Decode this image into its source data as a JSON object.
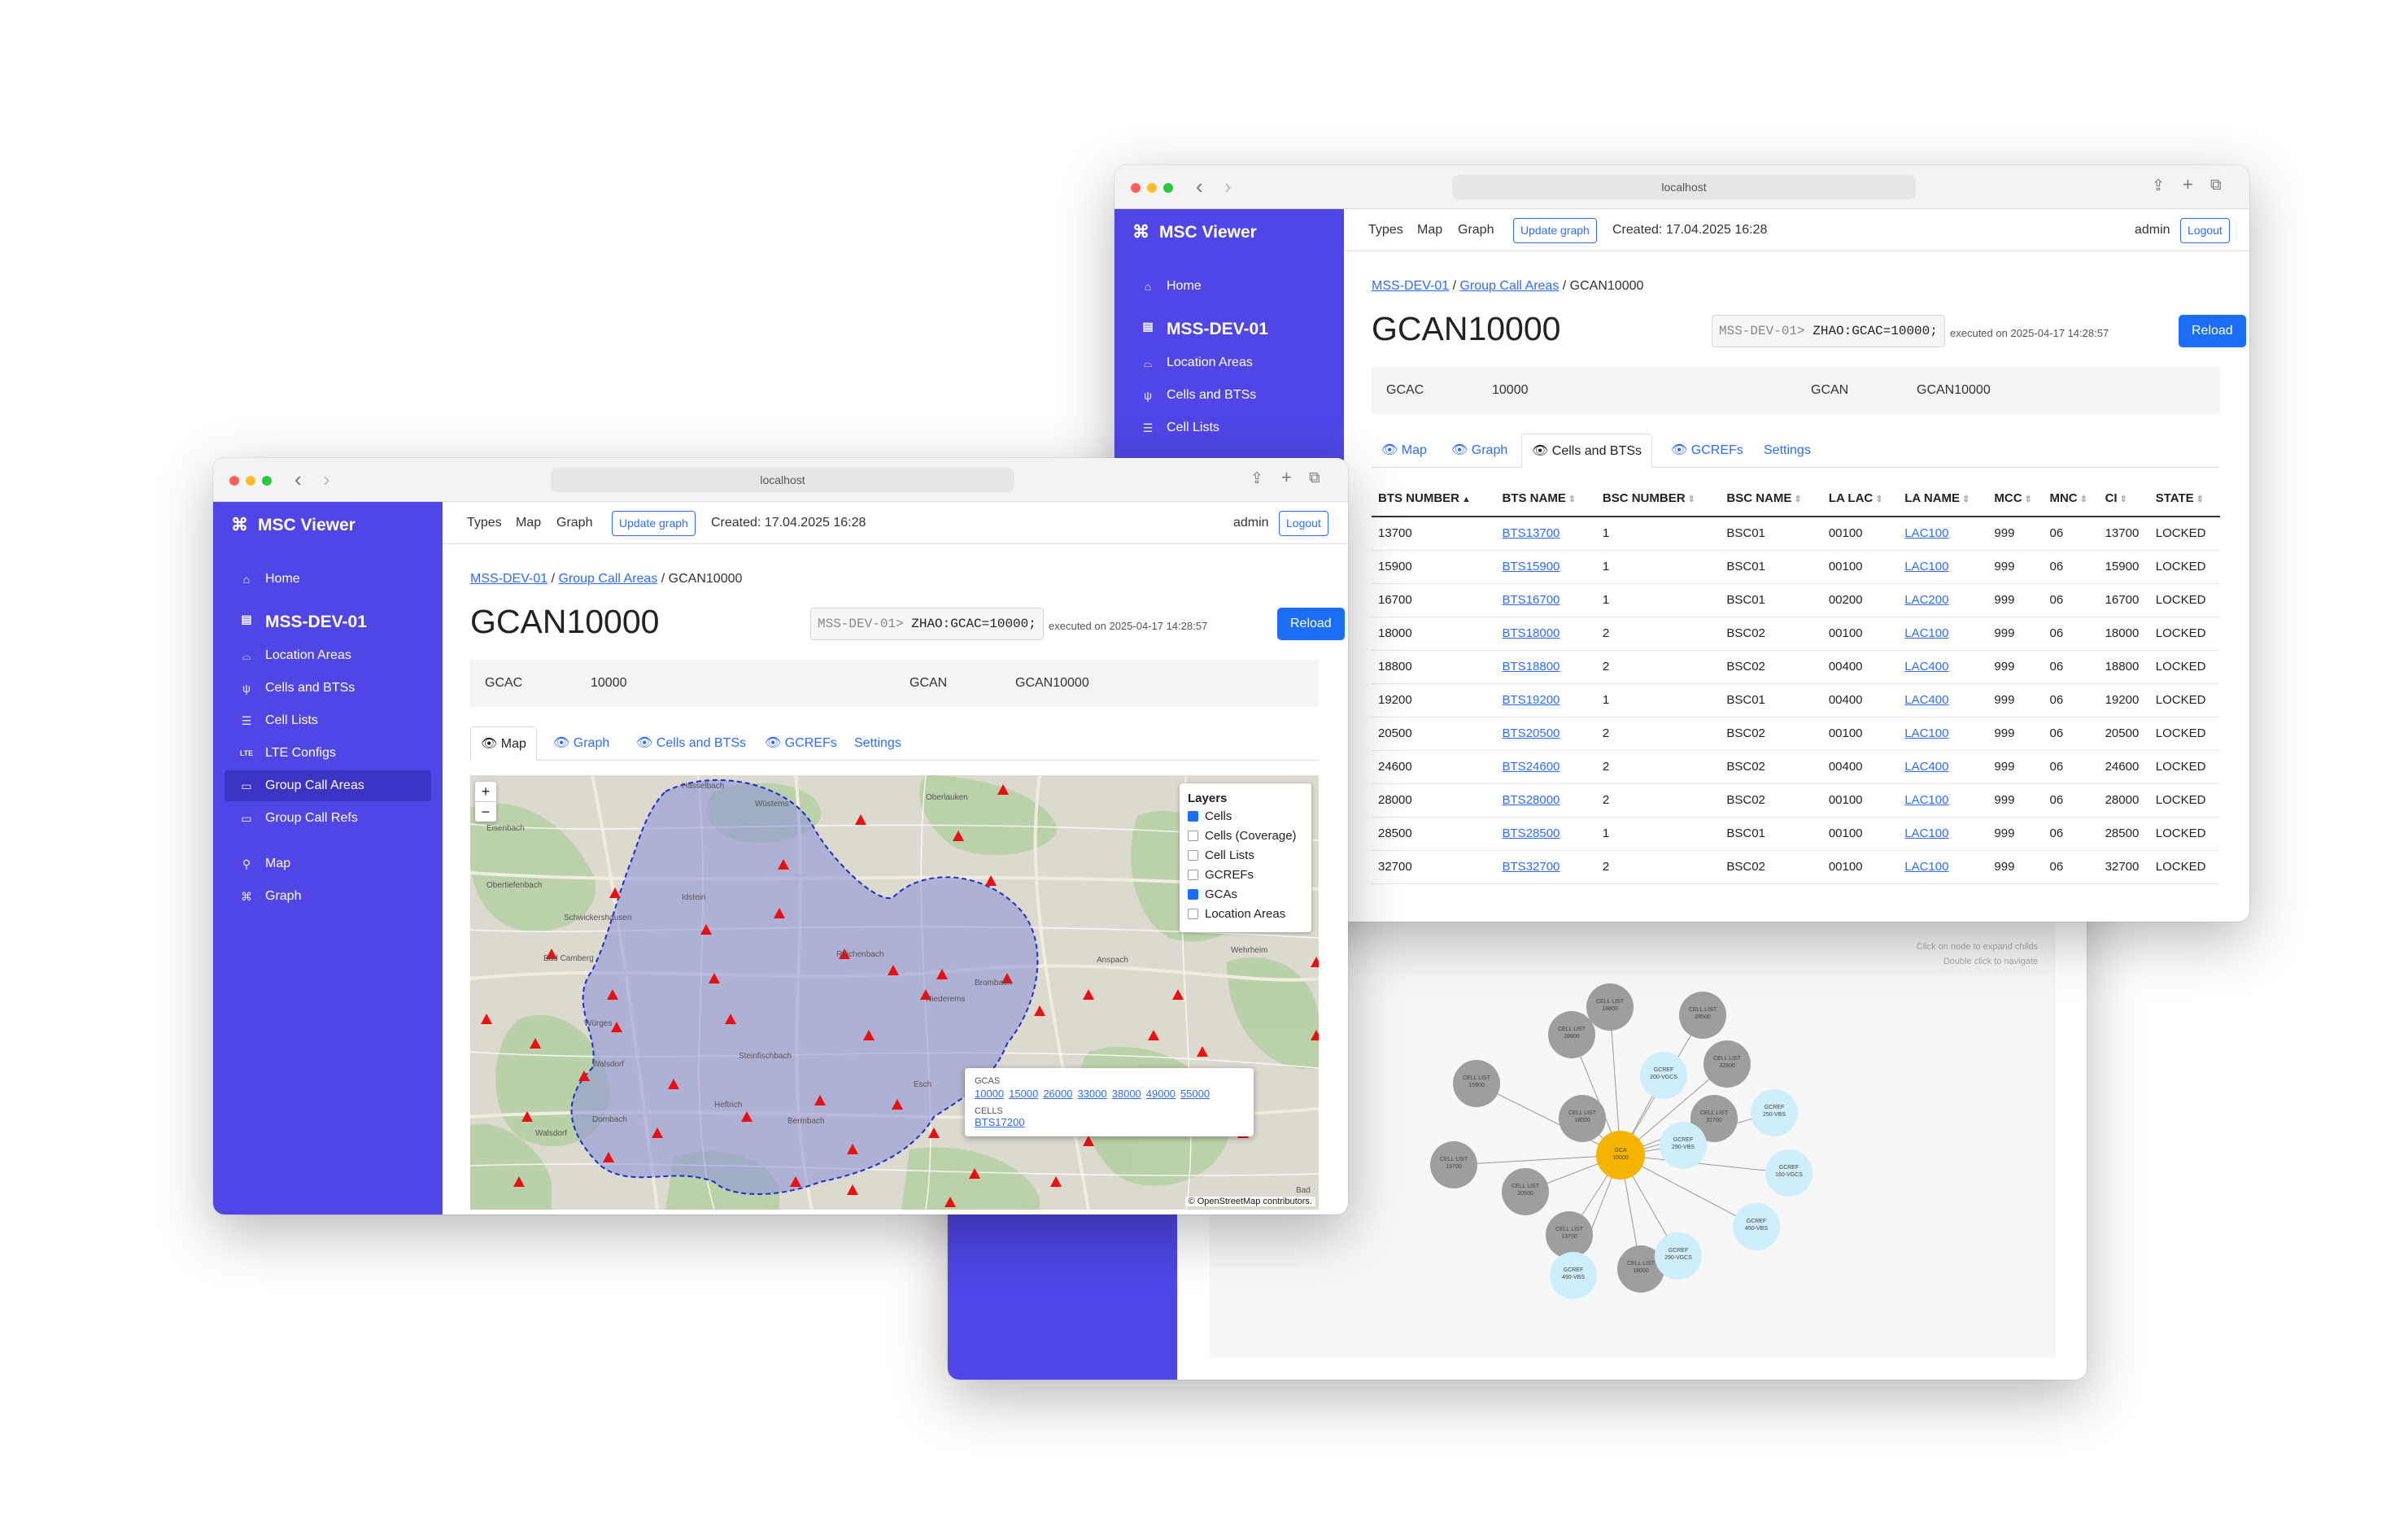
{
  "url": "localhost",
  "brand": "MSC Viewer",
  "sidebar": {
    "home": "Home",
    "server": "MSS-DEV-01",
    "items": [
      "Location Areas",
      "Cells and BTSs",
      "Cell Lists",
      "LTE Configs",
      "Group Call Areas",
      "Group Call Refs"
    ],
    "map": "Map",
    "graph": "Graph"
  },
  "topnav": {
    "types": "Types",
    "map": "Map",
    "graph": "Graph",
    "update": "Update graph",
    "created": "Created: 17.04.2025 16:28",
    "user": "admin",
    "logout": "Logout"
  },
  "breadcrumb": {
    "server": "MSS-DEV-01",
    "section": "Group Call Areas",
    "current": "GCAN10000"
  },
  "title": "GCAN10000",
  "command": {
    "prompt": "MSS-DEV-01>",
    "text": "ZHAO:GCAC=10000;",
    "executed_label": "executed on",
    "executed_at": "2025-04-17 14:28:57",
    "reload": "Reload"
  },
  "kv": {
    "gcac_label": "GCAC",
    "gcac_value": "10000",
    "gcan_label": "GCAN",
    "gcan_value": "GCAN10000"
  },
  "tabs": [
    "Map",
    "Graph",
    "Cells and BTSs",
    "GCREFs",
    "Settings"
  ],
  "map": {
    "layers_title": "Layers",
    "layers": [
      {
        "label": "Cells",
        "checked": true
      },
      {
        "label": "Cells (Coverage)",
        "checked": false
      },
      {
        "label": "Cell Lists",
        "checked": false
      },
      {
        "label": "GCREFs",
        "checked": false
      },
      {
        "label": "GCAs",
        "checked": true
      },
      {
        "label": "Location Areas",
        "checked": false
      }
    ],
    "popup": {
      "gcas_label": "GCAS",
      "gcas": [
        "10000",
        "15000",
        "26000",
        "33000",
        "38000",
        "49000",
        "55000"
      ],
      "cells_label": "CELLS",
      "cells": [
        "BTS17200"
      ]
    },
    "attribution": "© OpenStreetMap contributors.",
    "places": [
      "Hasselbach",
      "Oberlauken",
      "Eisenbach",
      "Obertiefenbach",
      "Schwickershausen",
      "Bad Camberg",
      "Würges",
      "Walsdorf",
      "Steinfischbach",
      "Reichenbach",
      "Niederems",
      "Esch",
      "Idstein",
      "Anspach",
      "Wehrheim",
      "Wüstems",
      "Dombach",
      "Bermbach",
      "Heftrich",
      "Walsdorf",
      "Weilburg",
      "Brombach",
      "Eschenhahn",
      "Bad"
    ]
  },
  "table": {
    "headers": [
      "BTS NUMBER",
      "BTS NAME",
      "BSC NUMBER",
      "BSC NAME",
      "LA LAC",
      "LA NAME",
      "MCC",
      "MNC",
      "CI",
      "STATE"
    ],
    "rows": [
      [
        "13700",
        "BTS13700",
        "1",
        "BSC01",
        "00100",
        "LAC100",
        "999",
        "06",
        "13700",
        "LOCKED"
      ],
      [
        "15900",
        "BTS15900",
        "1",
        "BSC01",
        "00100",
        "LAC100",
        "999",
        "06",
        "15900",
        "LOCKED"
      ],
      [
        "16700",
        "BTS16700",
        "1",
        "BSC01",
        "00200",
        "LAC200",
        "999",
        "06",
        "16700",
        "LOCKED"
      ],
      [
        "18000",
        "BTS18000",
        "2",
        "BSC02",
        "00100",
        "LAC100",
        "999",
        "06",
        "18000",
        "LOCKED"
      ],
      [
        "18800",
        "BTS18800",
        "2",
        "BSC02",
        "00400",
        "LAC400",
        "999",
        "06",
        "18800",
        "LOCKED"
      ],
      [
        "19200",
        "BTS19200",
        "1",
        "BSC01",
        "00400",
        "LAC400",
        "999",
        "06",
        "19200",
        "LOCKED"
      ],
      [
        "20500",
        "BTS20500",
        "2",
        "BSC02",
        "00100",
        "LAC100",
        "999",
        "06",
        "20500",
        "LOCKED"
      ],
      [
        "24600",
        "BTS24600",
        "2",
        "BSC02",
        "00400",
        "LAC400",
        "999",
        "06",
        "24600",
        "LOCKED"
      ],
      [
        "28000",
        "BTS28000",
        "2",
        "BSC02",
        "00100",
        "LAC100",
        "999",
        "06",
        "28000",
        "LOCKED"
      ],
      [
        "28500",
        "BTS28500",
        "1",
        "BSC01",
        "00100",
        "LAC100",
        "999",
        "06",
        "28500",
        "LOCKED"
      ],
      [
        "32700",
        "BTS32700",
        "2",
        "BSC02",
        "00100",
        "LAC100",
        "999",
        "06",
        "32700",
        "LOCKED"
      ]
    ]
  },
  "graph": {
    "hint1": "Click on node to expand childs",
    "hint2": "Double click to navigate",
    "center": {
      "label": "GCA",
      "value": "10000"
    },
    "nodes": [
      {
        "label": "CELL LIST",
        "value": "18800",
        "kind": "cell"
      },
      {
        "label": "CELL LIST",
        "value": "28500",
        "kind": "cell"
      },
      {
        "label": "CELL LIST",
        "value": "28800",
        "kind": "cell"
      },
      {
        "label": "CELL LIST",
        "value": "32800",
        "kind": "cell"
      },
      {
        "label": "CELL LIST",
        "value": "15900",
        "kind": "cell"
      },
      {
        "label": "CELL LIST",
        "value": "18000",
        "kind": "cell"
      },
      {
        "label": "CELL LIST",
        "value": "32700",
        "kind": "cell"
      },
      {
        "label": "CELL LIST",
        "value": "19700",
        "kind": "cell"
      },
      {
        "label": "CELL LIST",
        "value": "20500",
        "kind": "cell"
      },
      {
        "label": "CELL LIST",
        "value": "13700",
        "kind": "cell"
      },
      {
        "label": "CELL LIST",
        "value": "18000",
        "kind": "cell"
      },
      {
        "label": "GCREF",
        "value": "200-VGCS",
        "kind": "ref"
      },
      {
        "label": "GCREF",
        "value": "250-VBS",
        "kind": "ref"
      },
      {
        "label": "GCREF",
        "value": "290-VBS",
        "kind": "ref"
      },
      {
        "label": "GCREF",
        "value": "160-VGCS",
        "kind": "ref"
      },
      {
        "label": "GCREF",
        "value": "450-VBS",
        "kind": "ref"
      },
      {
        "label": "GCREF",
        "value": "290-VGCS",
        "kind": "ref"
      },
      {
        "label": "GCREF",
        "value": "490-VBS",
        "kind": "ref"
      }
    ]
  }
}
